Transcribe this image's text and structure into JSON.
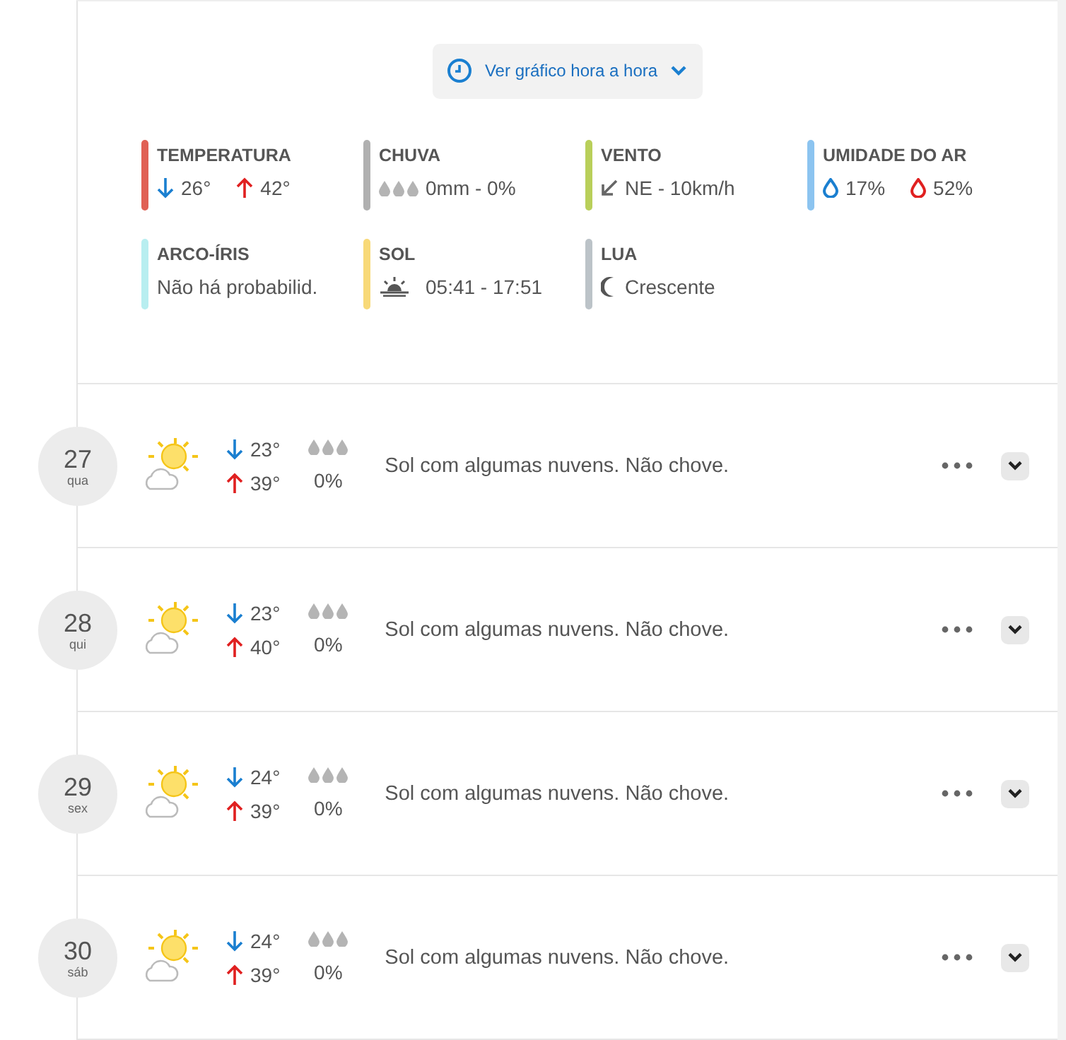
{
  "hourly_button": {
    "label": "Ver gráfico hora a hora"
  },
  "stats": [
    {
      "kind": "temperature",
      "title": "TEMPERATURA",
      "color": "#e06155",
      "min": "26°",
      "max": "42°"
    },
    {
      "kind": "rain",
      "title": "CHUVA",
      "color": "#b0b0b0",
      "value": "0mm - 0%"
    },
    {
      "kind": "wind",
      "title": "VENTO",
      "color": "#b9cf5a",
      "value": "NE - 10km/h"
    },
    {
      "kind": "humidity",
      "title": "UMIDADE DO AR",
      "color": "#8cc4f0",
      "min": "17%",
      "max": "52%"
    },
    {
      "kind": "text",
      "title": "ARCO-ÍRIS",
      "color": "#b8eef0",
      "value": "Não há probabilid."
    },
    {
      "kind": "sun",
      "title": "SOL",
      "color": "#f8d978",
      "value": "05:41 - 17:51"
    },
    {
      "kind": "moon",
      "title": "LUA",
      "color": "#bcc3c8",
      "value": "Crescente"
    }
  ],
  "days": [
    {
      "day": "27",
      "weekday": "qua",
      "min": "23°",
      "max": "39°",
      "rain": "0%",
      "summary": "Sol com algumas nuvens. Não chove."
    },
    {
      "day": "28",
      "weekday": "qui",
      "min": "23°",
      "max": "40°",
      "rain": "0%",
      "summary": "Sol com algumas nuvens. Não chove."
    },
    {
      "day": "29",
      "weekday": "sex",
      "min": "24°",
      "max": "39°",
      "rain": "0%",
      "summary": "Sol com algumas nuvens. Não chove."
    },
    {
      "day": "30",
      "weekday": "sáb",
      "min": "24°",
      "max": "39°",
      "rain": "0%",
      "summary": "Sol com algumas nuvens. Não chove."
    }
  ]
}
